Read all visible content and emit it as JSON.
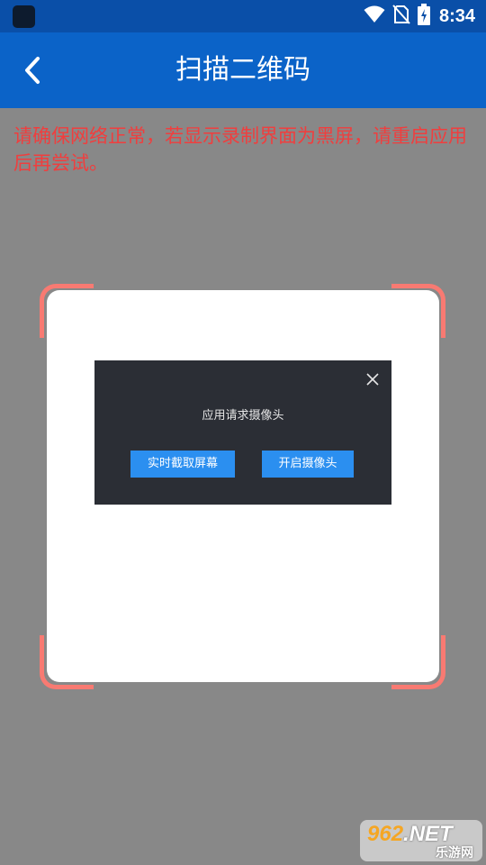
{
  "status_bar": {
    "time": "8:34",
    "icons": [
      "wifi-icon",
      "no-sim-icon",
      "battery-charging-icon"
    ]
  },
  "app_bar": {
    "title": "扫描二维码",
    "back_icon": "chevron-left-icon"
  },
  "warning": {
    "text": "请确保网络正常，若显示录制界面为黑屏，请重启应用后再尝试。"
  },
  "colors": {
    "status_bar": "#0a4fa8",
    "app_bar": "#0b63c8",
    "background": "#888888",
    "warning": "#f03e3e",
    "corner": "#f87a72",
    "dialog_bg": "#2b2e35",
    "button": "#2b8ff0"
  },
  "dialog": {
    "message": "应用请求摄像头",
    "close_icon": "close-icon",
    "buttons": {
      "screen_capture": "实时截取屏幕",
      "open_camera": "开启摄像头"
    }
  },
  "watermark": {
    "digits": "962",
    "suffix": ".NET",
    "site": "乐游网"
  }
}
